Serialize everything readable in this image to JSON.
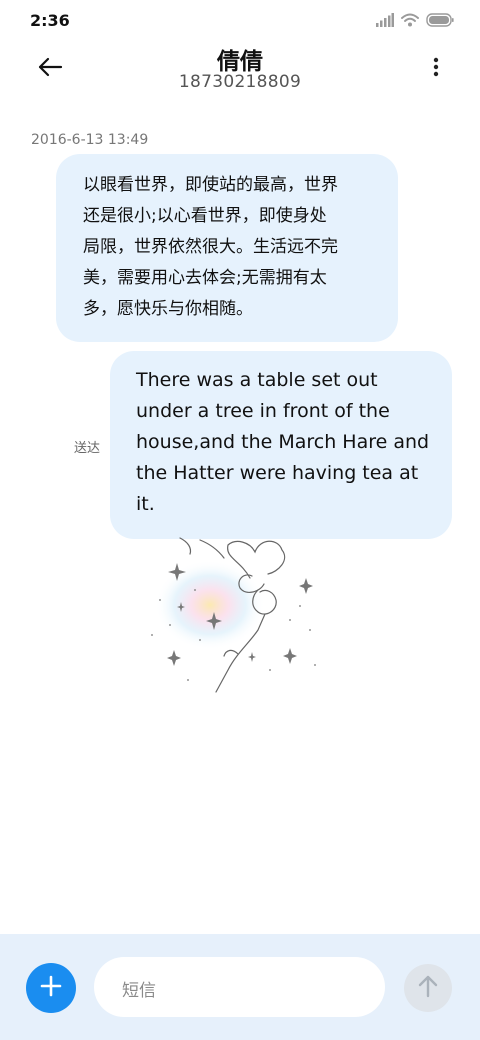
{
  "status_bar": {
    "time": "2:36",
    "icons": [
      "signal-icon",
      "wifi-icon",
      "battery-icon"
    ]
  },
  "header": {
    "name": "倩倩",
    "number": "18730218809",
    "back_icon": "arrow-left-icon",
    "more_icon": "more-vertical-icon"
  },
  "conversation": {
    "timestamp": "2016-6-13 13:49",
    "messages": [
      {
        "direction": "incoming",
        "lines": [
          "以眼看世界，即使站的最高，世界",
          "还是很小;以心看世界，即使身处",
          "局限，世界依然很大。生活远不完",
          "美，需要用心去体会;无需拥有太",
          "多，愿快乐与你相随。"
        ]
      },
      {
        "direction": "outgoing",
        "lines": [
          "There was a table set out",
          "under a tree in front of the",
          "house,and the March Hare and",
          "the Hatter were having tea at",
          "it."
        ],
        "status": "送达"
      }
    ]
  },
  "composer": {
    "placeholder": "短信",
    "add_icon": "plus-icon",
    "send_icon": "arrow-up-icon"
  },
  "colors": {
    "bubble": "#e6f2fd",
    "accent": "#1a8df0",
    "composer_bg": "#e6f0fb"
  }
}
